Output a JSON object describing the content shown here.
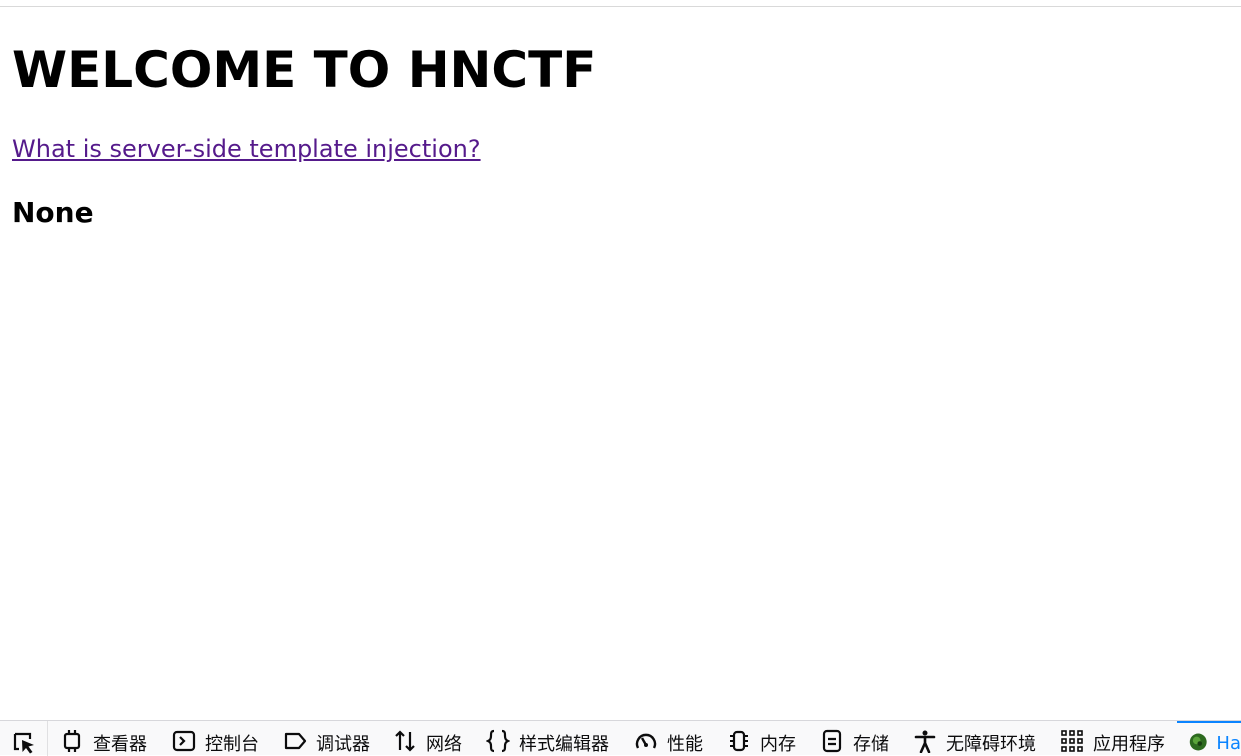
{
  "page": {
    "heading": "WELCOME TO HNCTF",
    "link_text": "What is server-side template injection?",
    "result": "None"
  },
  "devtools": {
    "tabs": [
      {
        "label": "查看器",
        "icon": "inspector-icon"
      },
      {
        "label": "控制台",
        "icon": "console-icon"
      },
      {
        "label": "调试器",
        "icon": "debugger-icon"
      },
      {
        "label": "网络",
        "icon": "network-icon"
      },
      {
        "label": "样式编辑器",
        "icon": "style-editor-icon"
      },
      {
        "label": "性能",
        "icon": "performance-icon"
      },
      {
        "label": "内存",
        "icon": "memory-icon"
      },
      {
        "label": "存储",
        "icon": "storage-icon"
      },
      {
        "label": "无障碍环境",
        "icon": "accessibility-icon"
      },
      {
        "label": "应用程序",
        "icon": "application-icon"
      },
      {
        "label": "Ha",
        "icon": "extension-icon"
      }
    ],
    "accent": "#0a84ff"
  }
}
